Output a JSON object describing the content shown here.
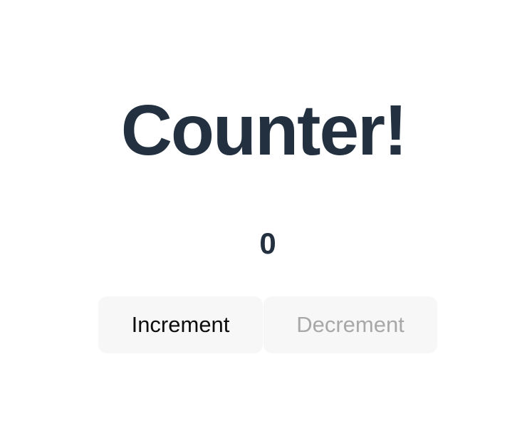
{
  "title": "Counter!",
  "counter": {
    "value": "0"
  },
  "buttons": {
    "increment_label": "Increment",
    "decrement_label": "Decrement",
    "decrement_disabled": true
  },
  "colors": {
    "text_dark": "#23303f",
    "button_bg": "#f7f7f7",
    "disabled_text": "#a8a8a8"
  }
}
